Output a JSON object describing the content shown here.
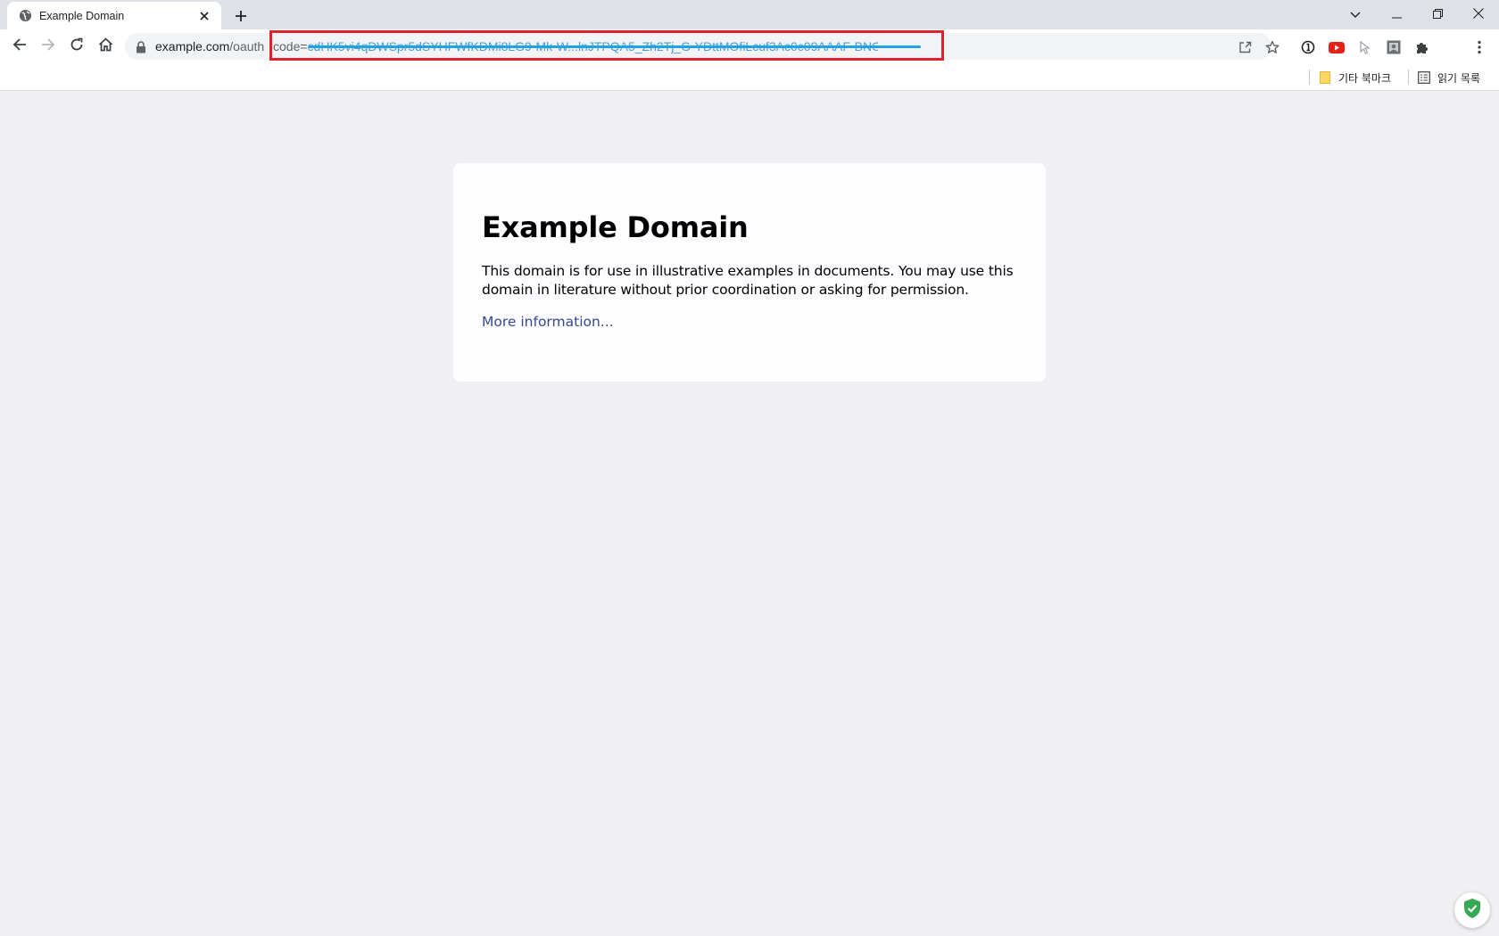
{
  "tab": {
    "title": "Example Domain",
    "favicon": "globe-icon",
    "close_icon": "close-icon"
  },
  "new_tab_icon": "plus-icon",
  "window_controls": [
    "tab-search-icon",
    "minimize-icon",
    "restore-icon",
    "close-icon"
  ],
  "nav": [
    "back-arrow-icon",
    "forward-arrow-icon",
    "reload-icon",
    "home-icon"
  ],
  "address_bar": {
    "host": "example.com",
    "path": "/oauth",
    "query": "code=",
    "query_redacted": "cdHK5vi4qDWSpr5dSYHFWfKDMi8LG9-Mk-W...lnJTPQA5_Zh2Tj_G-YDttMOfiLcuf3Ac0c09AAAF-BNO4cQ",
    "redaction_color": "#1fa2e6",
    "highlight_color": "#e0202a",
    "icons": [
      "share-icon",
      "bookmark-star-icon"
    ]
  },
  "extensions": [
    "info-circle-icon",
    "youtube-icon",
    "cursor-icon",
    "profile-square-icon",
    "puzzle-icon",
    "more-vert-icon"
  ],
  "bookmarks": {
    "other_bookmarks": "기타 북마크",
    "reading_list": "읽기 목록"
  },
  "page": {
    "heading": "Example Domain",
    "body": "This domain is for use in illustrative examples in documents. You may use this domain in literature without prior coordination or asking for permission.",
    "link": "More information..."
  },
  "colors": {
    "page_bg": "#f0f0f2",
    "card_bg": "#fdfdff",
    "link": "#38488f"
  },
  "floating_badge": "shield-check-icon"
}
